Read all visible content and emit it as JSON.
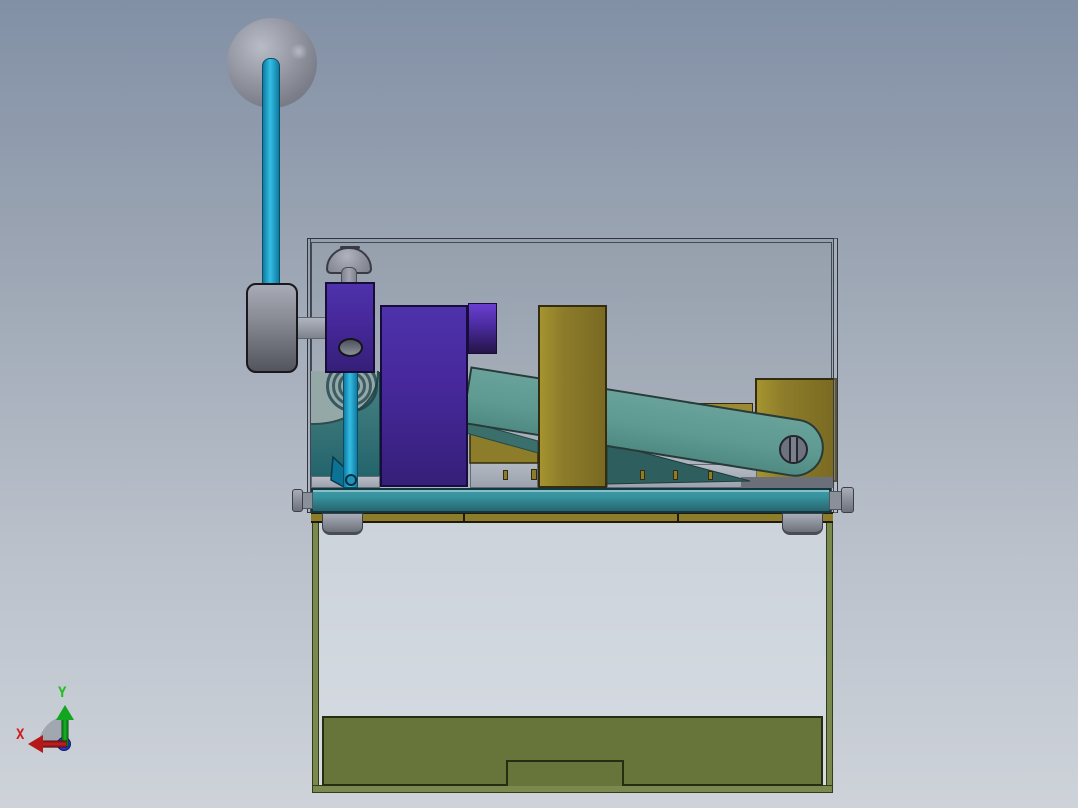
{
  "viewport": {
    "kind": "cad-3d-viewport",
    "view": "side view of lever-crank machine assembly on stand"
  },
  "triad": {
    "x_label": "X",
    "y_label": "Y"
  },
  "colors": {
    "bg_top": "#8290a6",
    "bg_mid": "#9aa4b2",
    "bg_low": "#bac1cb",
    "bg_bottom": "#ced3da",
    "outline": "#30353f",
    "cyan_light": "#35bde2",
    "cyan_dark": "#0e7ba3",
    "cyan_outline": "#0a4e66",
    "ball_hi": "#b8bcc6",
    "ball_dark": "#6e727d",
    "disc_top": "#a8abb5",
    "disc_bottom": "#53555e",
    "purple_main": "#46289a",
    "purple_outline": "#170d3a",
    "olive_light": "#a5942f",
    "olive_main": "#8d7c2a",
    "olive_dark": "#7a6a22",
    "olive_outline": "#332c10",
    "green_plate": "#68753a",
    "green_frame": "#7a894d",
    "green_outline": "#272d12",
    "teal_link": "#68a29a",
    "teal_link_dark": "#4f8a83",
    "teal_far": "#2e5f5e",
    "teal_panel_top": "#4a8483",
    "teal_panel_bottom": "#1f6069",
    "teal_cam": "#94a9a7",
    "link_outline": "#273c39",
    "base_top": "#35919c",
    "base_bottom": "#28646f",
    "base_outline": "#0f3840",
    "gray_strip": "#9da3ae",
    "gray_dark_strip": "#6b6f79",
    "metal_light": "#a8acb6",
    "metal_dark": "#6d717b",
    "metal_outline": "#3c3f49",
    "pin_gray": "#6e7280",
    "triad_red": "#b41818",
    "triad_green": "#12a51f",
    "triad_blue": "#2238c8",
    "triad_fan": "#9aa0a9"
  }
}
